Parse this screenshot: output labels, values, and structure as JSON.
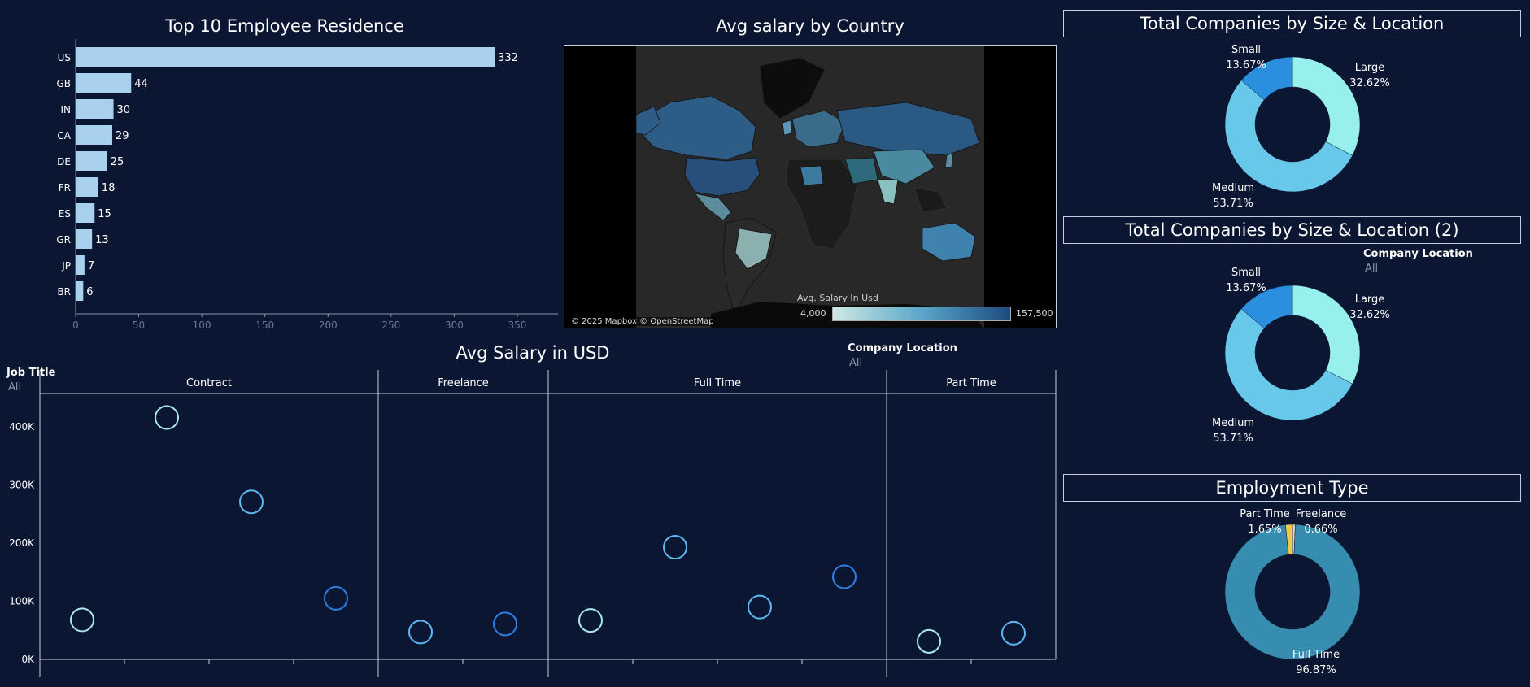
{
  "bar_title": "Top 10 Employee Residence",
  "map_title": "Avg salary by Country",
  "scatter_title": "Avg Salary in USD",
  "donut1_title": "Total Companies by Size & Location",
  "donut2_title": "Total Companies by Size & Location (2)",
  "donut3_title": "Employment Type",
  "map": {
    "attribution": "© 2025 Mapbox © OpenStreetMap",
    "legend_title": "Avg. Salary In Usd",
    "legend_min": "4,000",
    "legend_max": "157,500"
  },
  "filters": {
    "job_title_label": "Job Title",
    "job_title_value": "All",
    "company_location_label": "Company Location",
    "company_location_value": "All",
    "company_location2_label": "Company Location",
    "company_location2_value": "All"
  },
  "colors": {
    "background": "#0b1632",
    "bar": "#a9d1ee",
    "small": "#2b8fe0",
    "medium": "#67c8ea",
    "large": "#98f0ec",
    "full_time": "#378daf",
    "part_time": "#f0c94a",
    "freelance": "#d8d8c0"
  },
  "chart_data": [
    {
      "type": "bar",
      "orientation": "horizontal",
      "title": "Top 10 Employee Residence",
      "categories": [
        "US",
        "GB",
        "IN",
        "CA",
        "DE",
        "FR",
        "ES",
        "GR",
        "JP",
        "BR"
      ],
      "values": [
        332,
        44,
        30,
        29,
        25,
        18,
        15,
        13,
        7,
        6
      ],
      "xlim": [
        0,
        370
      ],
      "xticks": [
        0,
        50,
        100,
        150,
        200,
        250,
        300,
        350
      ]
    },
    {
      "type": "scatter",
      "title": "Avg Salary in USD",
      "panels": [
        "Contract",
        "Freelance",
        "Full Time",
        "Part Time"
      ],
      "yticks": [
        0,
        100000,
        200000,
        300000,
        400000
      ],
      "ytick_labels": [
        "0K",
        "100K",
        "200K",
        "300K",
        "400K"
      ],
      "points": [
        {
          "panel": "Contract",
          "slot": 0,
          "y": 68000,
          "size": "Large"
        },
        {
          "panel": "Contract",
          "slot": 1,
          "y": 416000,
          "size": "Large"
        },
        {
          "panel": "Contract",
          "slot": 2,
          "y": 271000,
          "size": "Medium"
        },
        {
          "panel": "Contract",
          "slot": 3,
          "y": 105000,
          "size": "Small"
        },
        {
          "panel": "Freelance",
          "slot": 0,
          "y": 47000,
          "size": "Medium"
        },
        {
          "panel": "Freelance",
          "slot": 1,
          "y": 61000,
          "size": "Small"
        },
        {
          "panel": "Full Time",
          "slot": 0,
          "y": 67000,
          "size": "Large"
        },
        {
          "panel": "Full Time",
          "slot": 1,
          "y": 193000,
          "size": "Medium"
        },
        {
          "panel": "Full Time",
          "slot": 2,
          "y": 90000,
          "size": "Medium"
        },
        {
          "panel": "Full Time",
          "slot": 3,
          "y": 142000,
          "size": "Small"
        },
        {
          "panel": "Part Time",
          "slot": 0,
          "y": 31000,
          "size": "Large"
        },
        {
          "panel": "Part Time",
          "slot": 1,
          "y": 45000,
          "size": "Medium"
        }
      ]
    },
    {
      "type": "pie",
      "donut": true,
      "title": "Total Companies by Size & Location",
      "slices": [
        {
          "label": "Large",
          "value": 32.62,
          "pct_label": "32.62%"
        },
        {
          "label": "Medium",
          "value": 53.71,
          "pct_label": "53.71%"
        },
        {
          "label": "Small",
          "value": 13.67,
          "pct_label": "13.67%"
        }
      ]
    },
    {
      "type": "pie",
      "donut": true,
      "title": "Total Companies by Size & Location (2)",
      "slices": [
        {
          "label": "Large",
          "value": 32.62,
          "pct_label": "32.62%"
        },
        {
          "label": "Medium",
          "value": 53.71,
          "pct_label": "53.71%"
        },
        {
          "label": "Small",
          "value": 13.67,
          "pct_label": "13.67%"
        }
      ]
    },
    {
      "type": "pie",
      "donut": true,
      "title": "Employment Type",
      "slices": [
        {
          "label": "Freelance",
          "value": 0.66,
          "pct_label": "0.66%"
        },
        {
          "label": "Full Time",
          "value": 96.87,
          "pct_label": "96.87%"
        },
        {
          "label": "Part Time",
          "value": 1.65,
          "pct_label": "1.65%"
        }
      ]
    }
  ]
}
